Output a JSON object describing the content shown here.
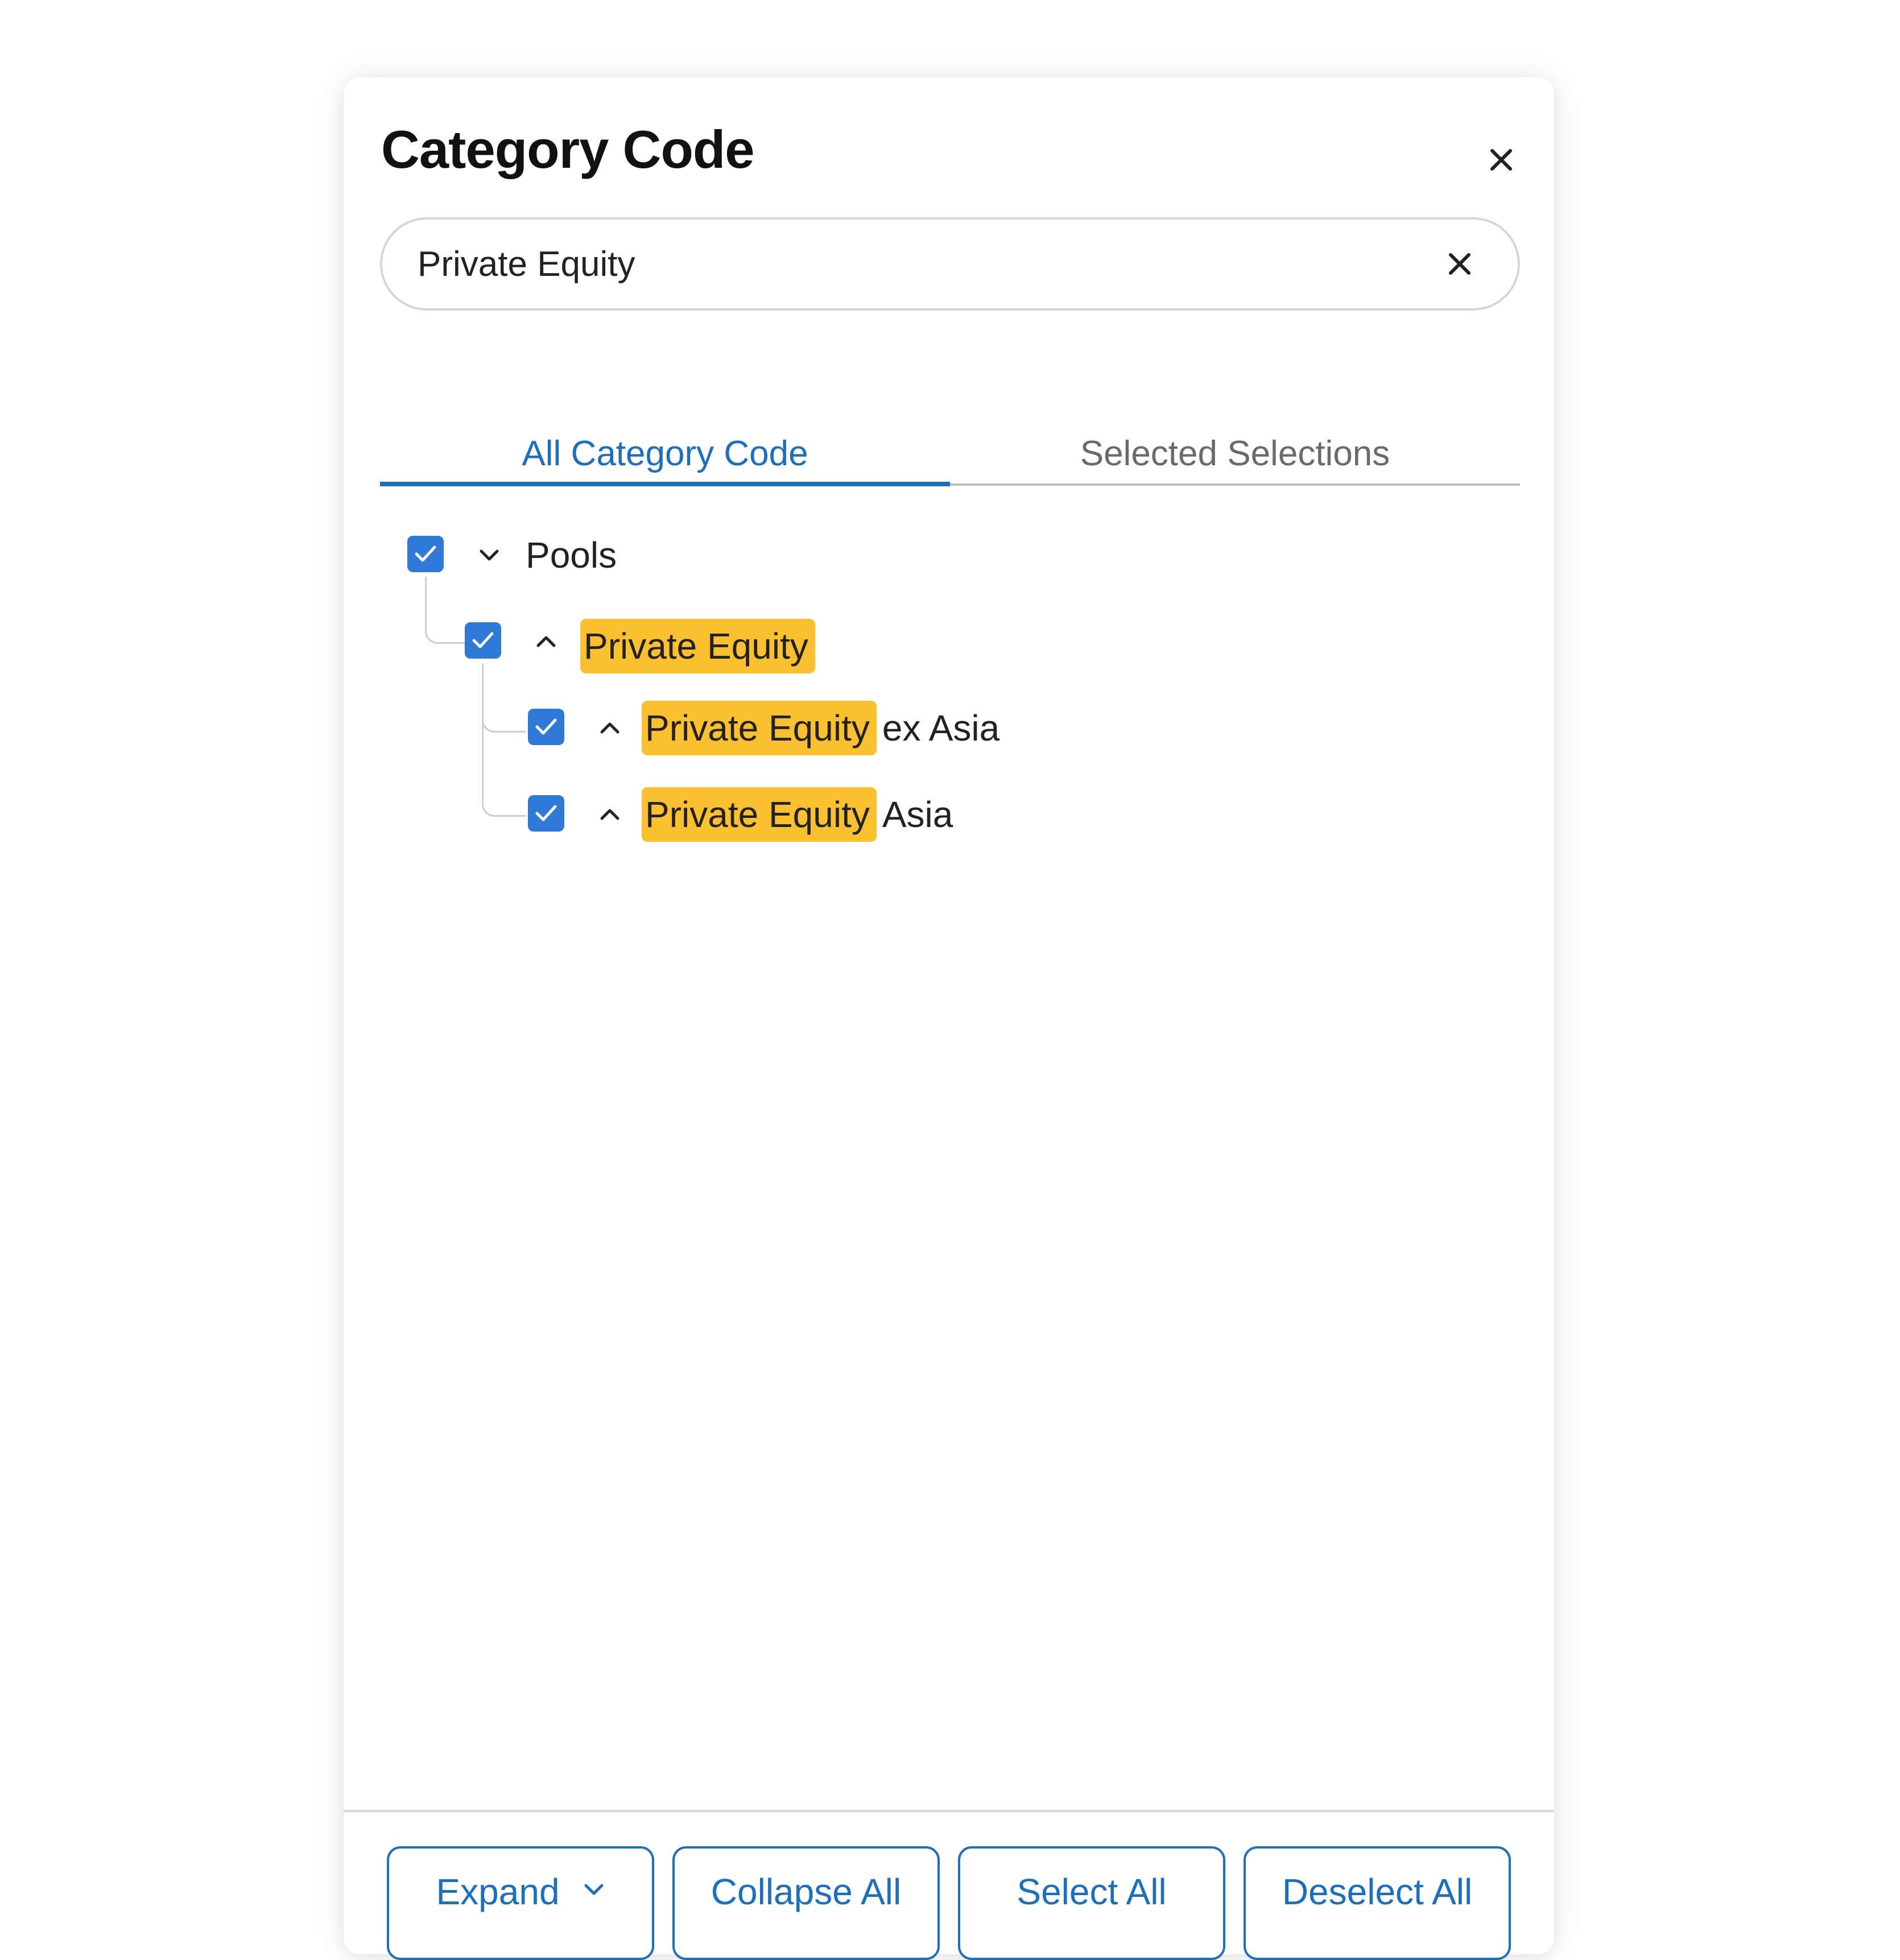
{
  "dialog": {
    "title": "Category Code",
    "close_icon": "close-icon"
  },
  "search": {
    "value": "Private Equity",
    "clear_icon": "close-icon"
  },
  "tabs": [
    {
      "label": "All Category Code",
      "active": true
    },
    {
      "label": "Selected Selections",
      "active": false
    }
  ],
  "tree": {
    "root": {
      "label": "Pools",
      "checked": true,
      "expand_icon": "chevron-down-icon"
    },
    "child": {
      "highlight": "Private Equity",
      "rest": "",
      "checked": true,
      "expand_icon": "chevron-up-icon"
    },
    "grandchildren": [
      {
        "highlight": "Private Equity",
        "rest": "ex Asia",
        "checked": true,
        "expand_icon": "chevron-up-icon"
      },
      {
        "highlight": "Private Equity",
        "rest": "Asia",
        "checked": true,
        "expand_icon": "chevron-up-icon"
      }
    ]
  },
  "footer": {
    "expand_label": "Expand",
    "collapse_all_label": "Collapse All",
    "select_all_label": "Select All",
    "deselect_all_label": "Deselect All"
  },
  "colors": {
    "accent": "#1a6fbf",
    "checkbox": "#2f7ad6",
    "highlight": "#fbc02d"
  }
}
